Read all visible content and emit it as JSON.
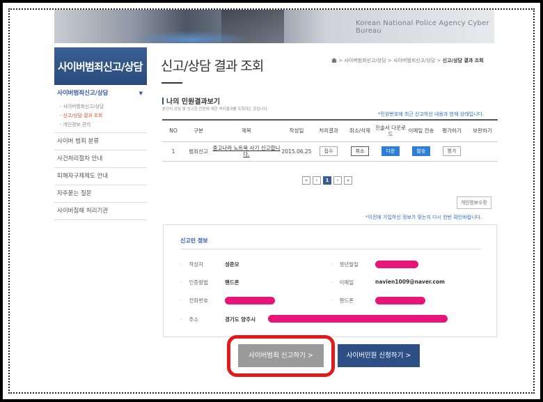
{
  "banner": {
    "text": "Korean National Police Agency Cyber Bureau"
  },
  "sidebar": {
    "title": "사이버범죄신고/상담",
    "active_item": "사이버범죄신고/상담",
    "sub_items": [
      "- 사이버범죄신고/상담",
      "- 신고/상담 결과 조회",
      "- 개인정보 관리"
    ],
    "items": [
      "사이버 범죄 분류",
      "사건처리절차 안내",
      "피해자구제제도 안내",
      "자주묻는 질문",
      "사이버침해 처리기관"
    ]
  },
  "header": {
    "title": "신고/상담 결과 조회",
    "breadcrumb": [
      "사이버범죄신고/상담",
      "사이버범죄신고/상담",
      "신고/상담 결과 조회"
    ]
  },
  "section": {
    "title": "나의 민원결과보기",
    "description": "본인이 상담 및 신고한 민원에 대한 처리결과를 조회하는 곳입니다.",
    "note": "*민원번호에 최근 신고하신 내용과 현재 상태입니다."
  },
  "table": {
    "headers": [
      "NO",
      "구분",
      "제목",
      "작성일",
      "처리결과",
      "취소/삭제",
      "진술서 다운로드",
      "이메일 전송",
      "평가하기",
      "보완하기"
    ],
    "rows": [
      {
        "no": "1",
        "type": "범죄신고",
        "title": "중고나라 노트북 사기 신고합니다.",
        "date": "2015.06.25",
        "status": "접수",
        "cancel": "취소",
        "download": "다운",
        "email": "발송",
        "evaluate": "평가"
      }
    ]
  },
  "pagination": {
    "first": "«",
    "prev": "‹",
    "current": "1",
    "next": "›",
    "last": "»"
  },
  "edit_info_button": "개인정보수정",
  "confirm_note": "*이전에 가입하신 정보가 맞는지 다시 한번 확인바랍니다.",
  "reporter": {
    "title": "신고인 정보",
    "author_label": "작성자",
    "author_value": "성준모",
    "birth_label": "생년월일",
    "auth_label": "인증방법",
    "auth_value": "핸드폰",
    "email_label": "이메일",
    "email_value": "navien1009@naver.com",
    "phone_label": "전화번호",
    "mobile_label": "핸드폰",
    "address_label": "주소",
    "address_value": "경기도 양주시"
  },
  "buttons": {
    "report": "사이버범죄 신고하기 >",
    "apply": "사이버민원 신청하기 >"
  },
  "colors": {
    "accent": "#2a58a8",
    "highlight": "#e01b1b",
    "redaction": "#e8147a"
  }
}
